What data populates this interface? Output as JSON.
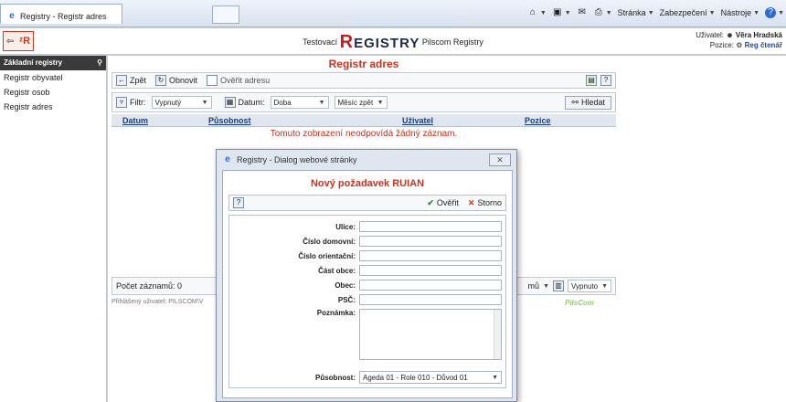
{
  "browser": {
    "tab_title": "Registry - Registr adres",
    "commands": [
      "Stránka",
      "Zabezpečení",
      "Nástroje"
    ]
  },
  "header": {
    "prefix": "Testovací",
    "brand_r": "R",
    "brand_rest": "EGISTRY",
    "suffix": "Pilscom Registry",
    "user_label": "Uživatel:",
    "user_name": "Věra Hradská",
    "role_label": "Pozice:",
    "role_value": "Reg čtenář"
  },
  "sidebar": {
    "title": "Základní registry",
    "items": [
      {
        "label": "Registr obyvatel"
      },
      {
        "label": "Registr osob"
      },
      {
        "label": "Registr adres"
      }
    ]
  },
  "main": {
    "title": "Registr adres",
    "toolbar": {
      "back": "Zpět",
      "refresh": "Obnovit",
      "verify": "Ověřit adresu"
    },
    "filter": {
      "filter_label": "Filtr:",
      "filter_value": "Vypnutý",
      "date_label": "Datum:",
      "date_value": "Doba",
      "range_value": "Měsíc zpět",
      "search": "Hledat"
    },
    "columns": [
      "Datum",
      "Působnost",
      "Uživatel",
      "Pozice"
    ],
    "empty_message": "Tomuto zobrazení neodpovídá žádný záznam.",
    "footer": {
      "count": "Počet záznamů: 0",
      "pager_suffix": "mů",
      "pager_state": "Vypnuto"
    },
    "logged_user": "Přihlášený uživatel: PILSCOM\\V",
    "watermark": "PilsCom"
  },
  "dialog": {
    "title": "Registry - Dialog webové stránky",
    "heading": "Nový požadavek RUIAN",
    "verify_btn": "Ověřit",
    "cancel_btn": "Storno",
    "fields": {
      "ulice": "Ulice:",
      "cislo_domovni": "Číslo domovní:",
      "cislo_orientacni": "Číslo orientační:",
      "cast_obce": "Část obce:",
      "obec": "Obec:",
      "psc": "PSČ:",
      "poznamka": "Poznámka:",
      "pusobnost": "Působnost:"
    },
    "pusobnost_value": "Ageda 01 - Role 010 - Důvod 01"
  }
}
